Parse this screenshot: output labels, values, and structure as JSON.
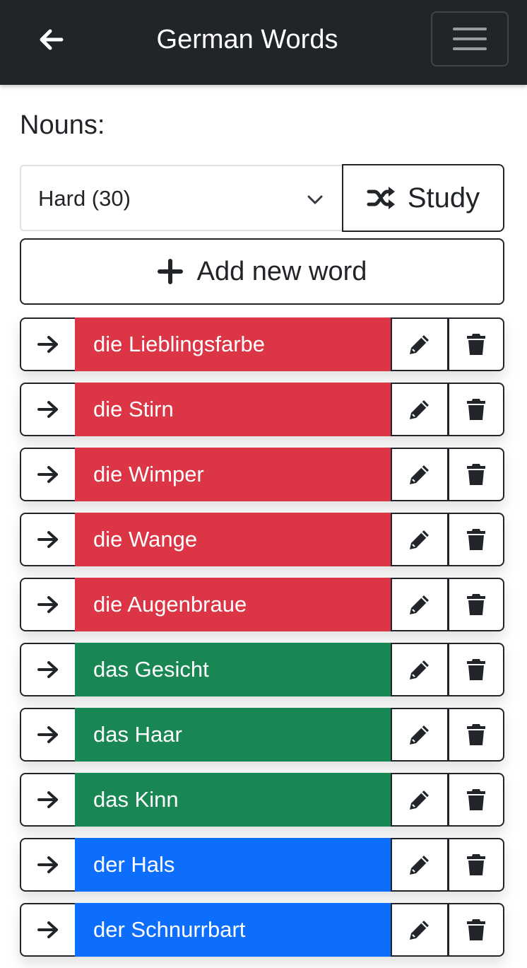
{
  "header": {
    "title": "German Words",
    "back_icon": "arrow-left-icon",
    "menu_icon": "hamburger-menu-icon"
  },
  "section": {
    "title": "Nouns:"
  },
  "filter": {
    "selected": "Hard (30)"
  },
  "study_button": {
    "label": "Study",
    "icon": "shuffle-icon"
  },
  "add_button": {
    "label": "Add new word",
    "icon": "plus-icon"
  },
  "colors": {
    "feminine": "#dc3545",
    "neuter": "#198754",
    "masculine": "#0d6efd",
    "navbar": "#212529"
  },
  "words": [
    {
      "text": "die Lieblingsfarbe",
      "gender": "feminine"
    },
    {
      "text": "die Stirn",
      "gender": "feminine"
    },
    {
      "text": "die Wimper",
      "gender": "feminine"
    },
    {
      "text": "die Wange",
      "gender": "feminine"
    },
    {
      "text": "die Augenbraue",
      "gender": "feminine"
    },
    {
      "text": "das Gesicht",
      "gender": "neuter"
    },
    {
      "text": "das Haar",
      "gender": "neuter"
    },
    {
      "text": "das Kinn",
      "gender": "neuter"
    },
    {
      "text": "der Hals",
      "gender": "masculine"
    },
    {
      "text": "der Schnurrbart",
      "gender": "masculine"
    }
  ]
}
